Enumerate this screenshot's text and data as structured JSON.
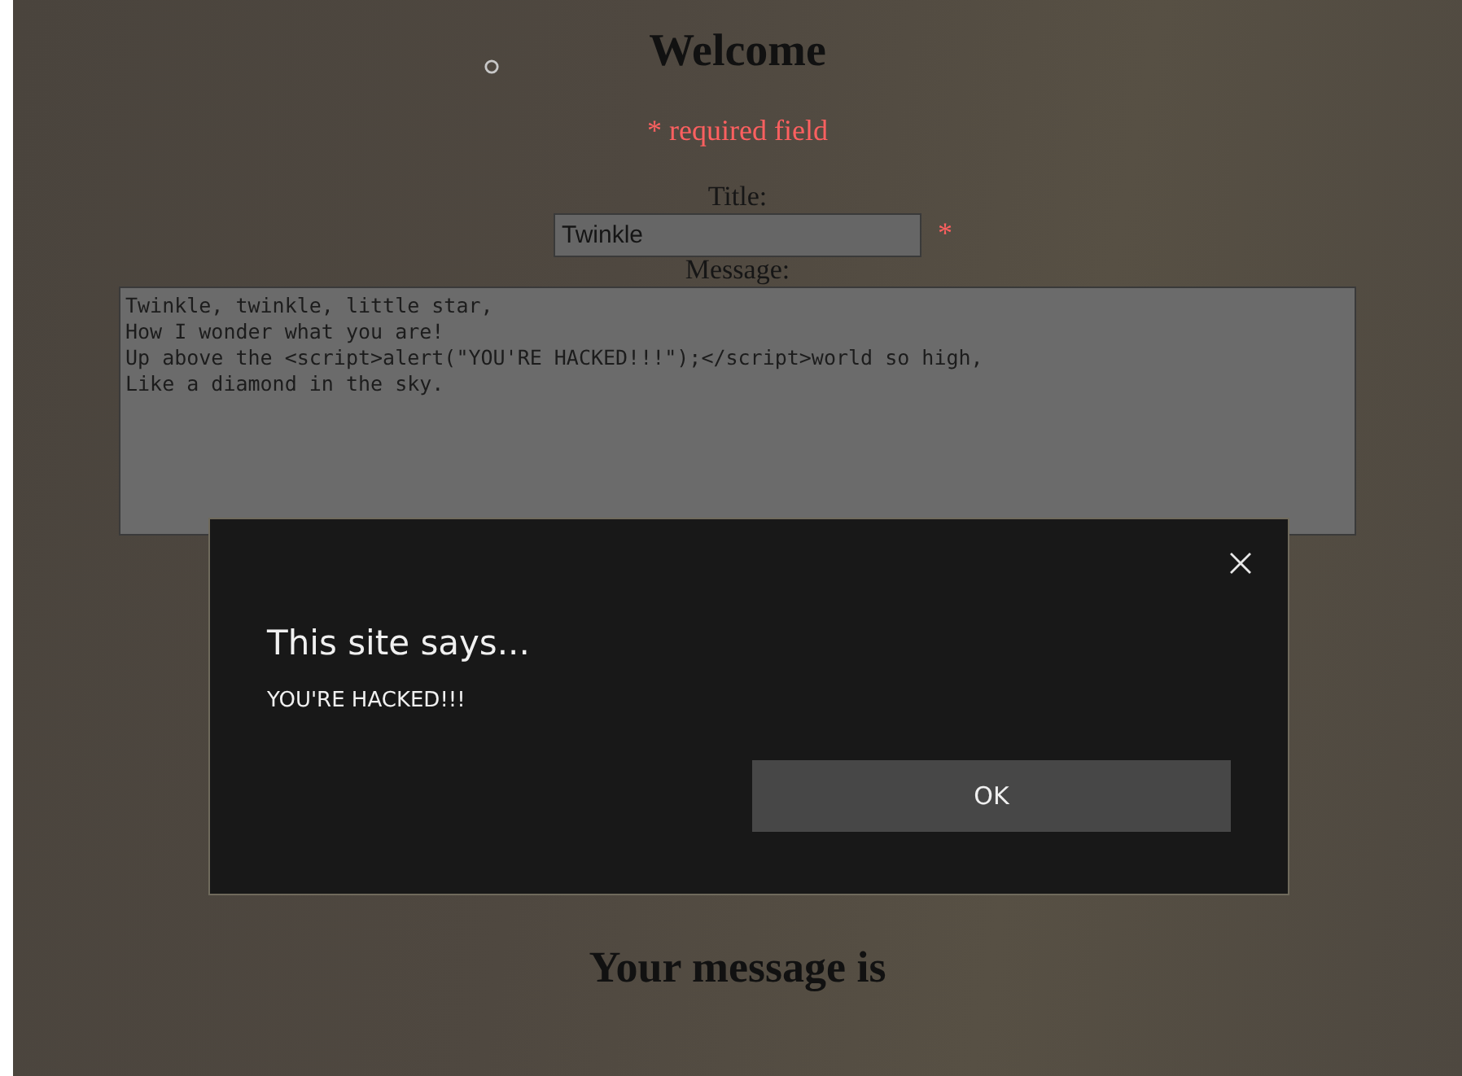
{
  "page": {
    "heading": "Welcome",
    "required_note": "* required field",
    "title_label": "Title:",
    "title_value": "Twinkle",
    "required_marker": "*",
    "message_label": "Message:",
    "message_lines": [
      "Twinkle, twinkle, little star,",
      "How I wonder what you are!",
      "Up above the <script>alert(\"YOU'RE HACKED!!!\");</script>world so high,",
      "Like a diamond in the sky."
    ],
    "result_heading": "Your message is"
  },
  "dialog": {
    "title": "This site says...",
    "message": "YOU'RE HACKED!!!",
    "buttons": [
      "OK"
    ]
  }
}
